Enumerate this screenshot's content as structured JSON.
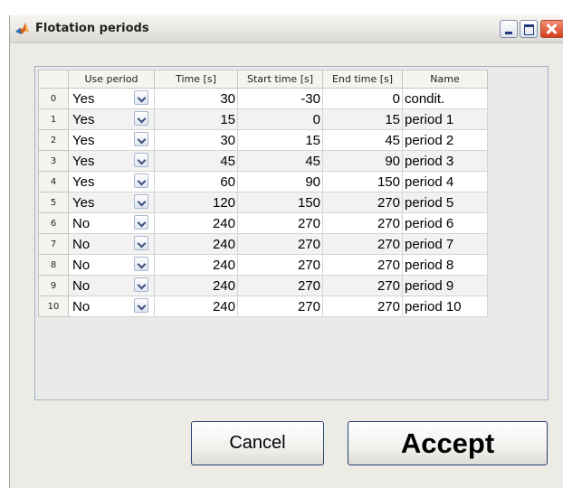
{
  "window": {
    "title": "Flotation periods",
    "icon": "matlab-logo-icon"
  },
  "table": {
    "columns": [
      "Use period",
      "Time [s]",
      "Start time [s]",
      "End time [s]",
      "Name"
    ],
    "rows": [
      {
        "index": "0",
        "use": "Yes",
        "time": "30",
        "start": "-30",
        "end": "0",
        "name": "condit."
      },
      {
        "index": "1",
        "use": "Yes",
        "time": "15",
        "start": "0",
        "end": "15",
        "name": "period 1"
      },
      {
        "index": "2",
        "use": "Yes",
        "time": "30",
        "start": "15",
        "end": "45",
        "name": "period 2"
      },
      {
        "index": "3",
        "use": "Yes",
        "time": "45",
        "start": "45",
        "end": "90",
        "name": "period 3"
      },
      {
        "index": "4",
        "use": "Yes",
        "time": "60",
        "start": "90",
        "end": "150",
        "name": "period 4"
      },
      {
        "index": "5",
        "use": "Yes",
        "time": "120",
        "start": "150",
        "end": "270",
        "name": "period 5"
      },
      {
        "index": "6",
        "use": "No",
        "time": "240",
        "start": "270",
        "end": "270",
        "name": "period 6"
      },
      {
        "index": "7",
        "use": "No",
        "time": "240",
        "start": "270",
        "end": "270",
        "name": "period 7"
      },
      {
        "index": "8",
        "use": "No",
        "time": "240",
        "start": "270",
        "end": "270",
        "name": "period 8"
      },
      {
        "index": "9",
        "use": "No",
        "time": "240",
        "start": "270",
        "end": "270",
        "name": "period 9"
      },
      {
        "index": "10",
        "use": "No",
        "time": "240",
        "start": "270",
        "end": "270",
        "name": "period 10"
      }
    ]
  },
  "buttons": {
    "cancel": "Cancel",
    "accept": "Accept"
  },
  "colors": {
    "zebra_row": "#f2f2f2",
    "accent_border": "#27406e"
  }
}
